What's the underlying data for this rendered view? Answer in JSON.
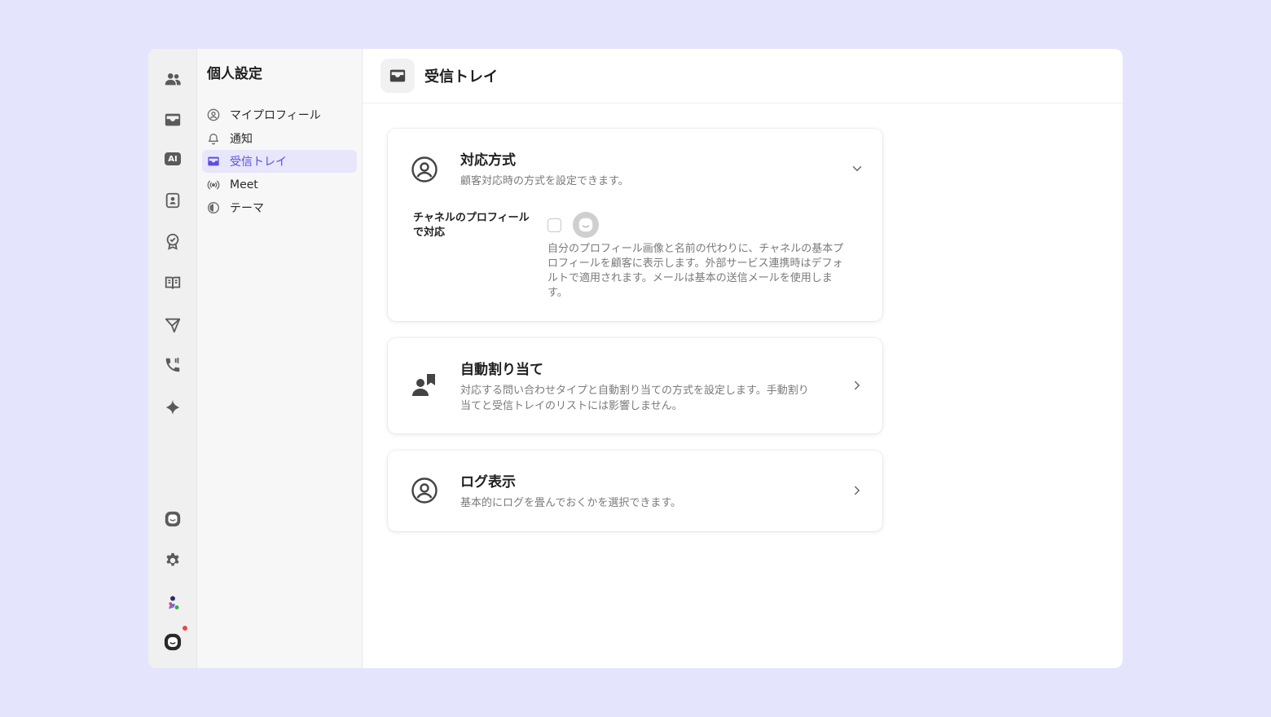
{
  "rail": {
    "items": [
      {
        "icon": "team-icon"
      },
      {
        "icon": "inbox-icon"
      },
      {
        "icon": "ai-icon",
        "label": "AI"
      },
      {
        "icon": "contacts-icon"
      },
      {
        "icon": "badge-icon"
      },
      {
        "icon": "book-icon"
      },
      {
        "icon": "send-icon"
      },
      {
        "icon": "phone-icon"
      },
      {
        "icon": "sparkle-icon"
      }
    ],
    "bottom": [
      {
        "icon": "channel-logo-icon"
      },
      {
        "icon": "gear-icon"
      },
      {
        "icon": "user-avatar"
      },
      {
        "icon": "workspace-logo-icon"
      }
    ]
  },
  "nav": {
    "title": "個人設定",
    "items": [
      {
        "label": "マイプロフィール",
        "icon": "profile-icon"
      },
      {
        "label": "通知",
        "icon": "bell-icon"
      },
      {
        "label": "受信トレイ",
        "icon": "inbox-icon",
        "active": true
      },
      {
        "label": "Meet",
        "icon": "broadcast-icon"
      },
      {
        "label": "テーマ",
        "icon": "theme-icon"
      }
    ]
  },
  "header": {
    "title": "受信トレイ"
  },
  "cards": [
    {
      "title": "対応方式",
      "description": "顧客対応時の方式を設定できます。",
      "expanded": true,
      "option": {
        "label": "チャネルのプロフィールで対応",
        "checked": false,
        "description": "自分のプロフィール画像と名前の代わりに、チャネルの基本プロフィールを顧客に表示します。外部サービス連携時はデフォルトで適用されます。メールは基本の送信メールを使用します。"
      }
    },
    {
      "title": "自動割り当て",
      "description": "対応する問い合わせタイプと自動割り当ての方式を設定します。手動割り当てと受信トレイのリストには影響しません。"
    },
    {
      "title": "ログ表示",
      "description": "基本的にログを畳んでおくかを選択できます。"
    }
  ],
  "colors": {
    "background": "#e4e4fd",
    "accent": "#5b4fe0",
    "active_nav_bg": "#e8e6fb",
    "notification": "#e5484d",
    "presence": "#2fb344"
  }
}
